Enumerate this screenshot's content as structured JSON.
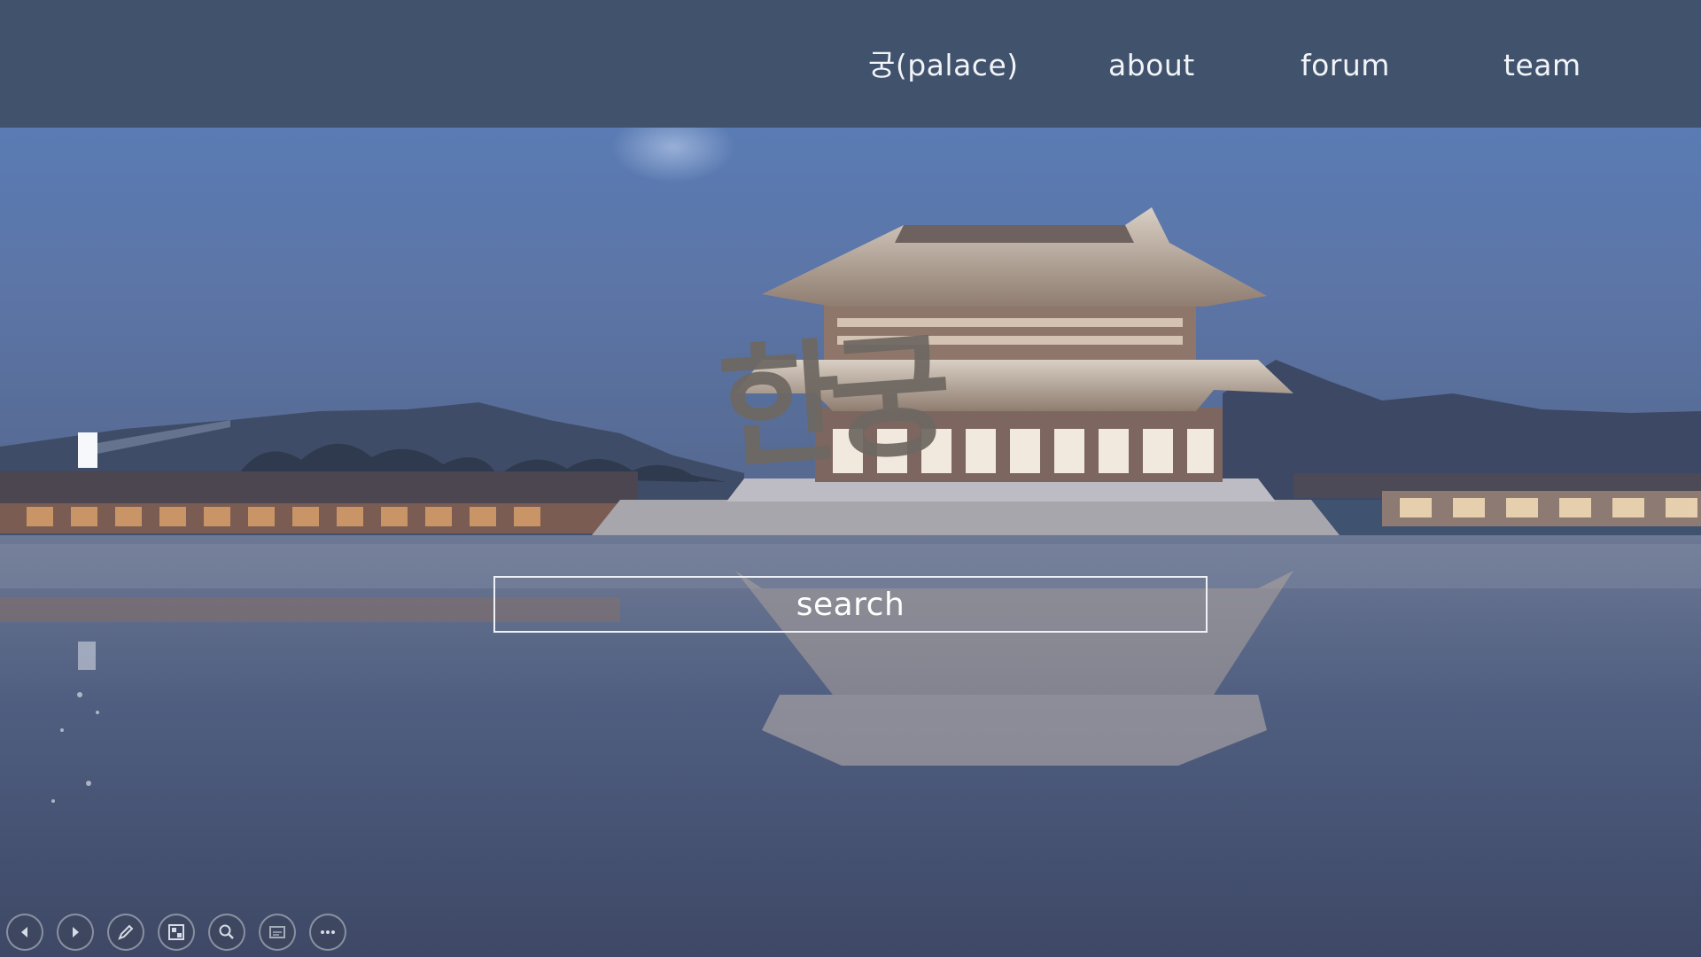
{
  "nav": {
    "items": [
      {
        "label": "궁(palace)"
      },
      {
        "label": "about"
      },
      {
        "label": "forum"
      },
      {
        "label": "team"
      }
    ]
  },
  "hero": {
    "logo_text": "한궁",
    "search": {
      "label": "search"
    }
  },
  "controls": {
    "icons": [
      "previous-icon",
      "next-icon",
      "pen-icon",
      "slides-grid-icon",
      "zoom-icon",
      "subtitles-icon",
      "more-icon"
    ]
  },
  "colors": {
    "nav_background": "#40526c",
    "nav_text": "#f2f4f8",
    "logo": "#6e6862",
    "search_border": "#eef1f6"
  }
}
